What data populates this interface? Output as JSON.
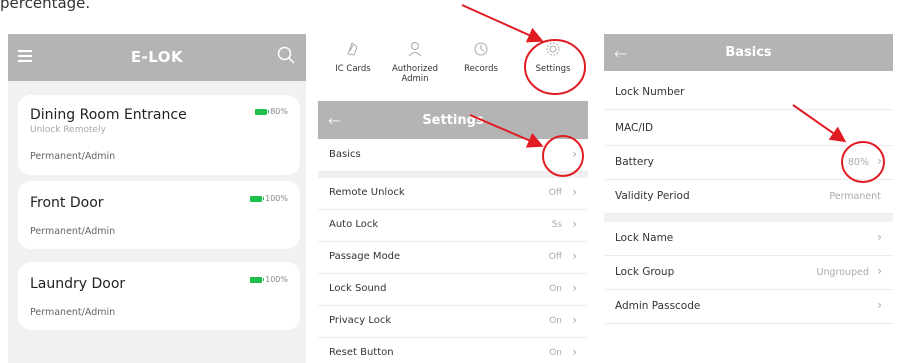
{
  "caption": "percentage.",
  "list_screen": {
    "title": "E-LOK",
    "icons": {
      "menu": "hamburger-icon",
      "search": "search-icon",
      "battery": "battery-icon"
    },
    "locks": [
      {
        "name": "Dining Room Entrance",
        "subtitle": "Unlock Remotely",
        "access": "Permanent/Admin",
        "battery": "80%"
      },
      {
        "name": "Front Door",
        "subtitle": "",
        "access": "Permanent/Admin",
        "battery": "100%"
      },
      {
        "name": "Laundry Door",
        "subtitle": "",
        "access": "Permanent/Admin",
        "battery": "100%"
      }
    ]
  },
  "settings_screen": {
    "tabs": [
      {
        "label": "IC Cards",
        "icon": "card-icon"
      },
      {
        "label": "Authorized Admin",
        "icon": "admin-user-icon"
      },
      {
        "label": "Records",
        "icon": "history-icon"
      },
      {
        "label": "Settings",
        "icon": "gear-icon"
      }
    ],
    "title": "Settings",
    "rows": [
      {
        "label": "Basics",
        "value": ""
      },
      {
        "label": "Remote Unlock",
        "value": "Off"
      },
      {
        "label": "Auto Lock",
        "value": "5s"
      },
      {
        "label": "Passage Mode",
        "value": "Off"
      },
      {
        "label": "Lock Sound",
        "value": "On"
      },
      {
        "label": "Privacy Lock",
        "value": "On"
      },
      {
        "label": "Reset Button",
        "value": "On"
      }
    ]
  },
  "basics_screen": {
    "title": "Basics",
    "rows": [
      {
        "label": "Lock Number",
        "value": ""
      },
      {
        "label": "MAC/ID",
        "value": ""
      },
      {
        "label": "Battery",
        "value": "80%"
      },
      {
        "label": "Validity Period",
        "value": "Permanent"
      },
      {
        "label": "Lock Name",
        "value": ""
      },
      {
        "label": "Lock Group",
        "value": "Ungrouped"
      },
      {
        "label": "Admin Passcode",
        "value": ""
      }
    ]
  },
  "colors": {
    "header_gray": "#b4b4b4",
    "battery_green": "#1fbf4d",
    "annotation_red": "#e01b22",
    "list_background": "#f1f1f1"
  }
}
